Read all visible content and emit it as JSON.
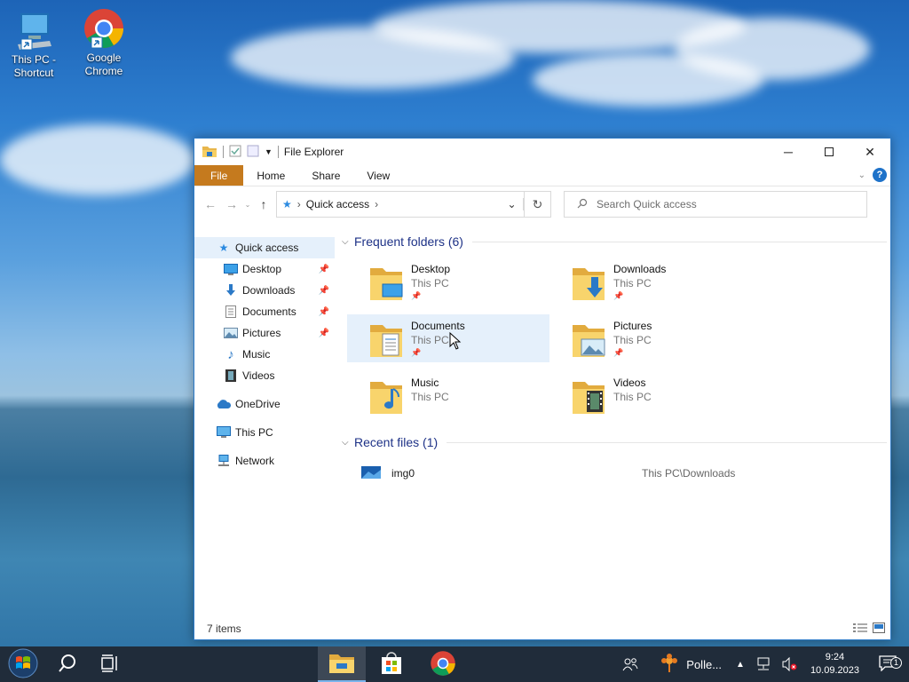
{
  "desktop": {
    "icons": [
      {
        "label": "This PC - Shortcut",
        "icon": "this-pc-icon"
      },
      {
        "label": "Google Chrome",
        "icon": "chrome-icon"
      }
    ]
  },
  "window": {
    "title": "File Explorer",
    "ribbon_tabs": [
      "File",
      "Home",
      "Share",
      "View"
    ],
    "address": {
      "crumb": "Quick access"
    },
    "search_placeholder": "Search Quick access",
    "sidebar": [
      {
        "label": "Quick access",
        "icon": "star-icon",
        "level": 0,
        "selected": true
      },
      {
        "label": "Desktop",
        "icon": "desktop-icon",
        "level": 1,
        "pinned": true
      },
      {
        "label": "Downloads",
        "icon": "download-icon",
        "level": 1,
        "pinned": true
      },
      {
        "label": "Documents",
        "icon": "documents-icon",
        "level": 1,
        "pinned": true
      },
      {
        "label": "Pictures",
        "icon": "pictures-icon",
        "level": 1,
        "pinned": true
      },
      {
        "label": "Music",
        "icon": "music-icon",
        "level": 1
      },
      {
        "label": "Videos",
        "icon": "videos-icon",
        "level": 1
      },
      {
        "label": "OneDrive",
        "icon": "cloud-icon",
        "level": 0
      },
      {
        "label": "This PC",
        "icon": "computer-icon",
        "level": 0
      },
      {
        "label": "Network",
        "icon": "network-icon",
        "level": 0
      }
    ],
    "frequent_header": "Frequent folders (6)",
    "frequent": [
      {
        "name": "Desktop",
        "location": "This PC",
        "pinned": true
      },
      {
        "name": "Downloads",
        "location": "This PC",
        "pinned": true
      },
      {
        "name": "Documents",
        "location": "This PC",
        "pinned": true
      },
      {
        "name": "Pictures",
        "location": "This PC",
        "pinned": true
      },
      {
        "name": "Music",
        "location": "This PC",
        "pinned": false
      },
      {
        "name": "Videos",
        "location": "This PC",
        "pinned": false
      }
    ],
    "recent_header": "Recent files (1)",
    "recent": [
      {
        "name": "img0",
        "path": "This PC\\Downloads"
      }
    ],
    "status": "7 items"
  },
  "taskbar": {
    "notification_app": "Polle...",
    "time": "9:24",
    "date": "10.09.2023",
    "notification_count": "1"
  },
  "colors": {
    "accent": "#1e72c9",
    "file_tab": "#c57a1e",
    "section_header": "#1e3287",
    "taskbar": "#202c3a"
  }
}
